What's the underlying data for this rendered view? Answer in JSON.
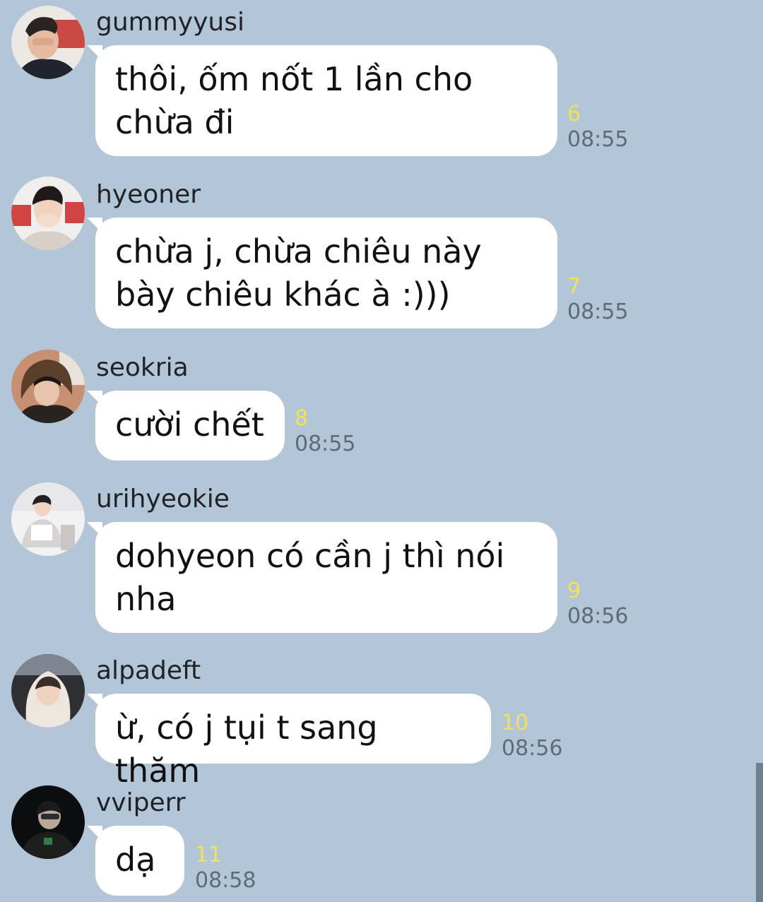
{
  "messages": [
    {
      "sender": "gummyyusi",
      "text": "thôi, ốm nốt 1 lần cho\nchừa đi",
      "read_count": "6",
      "time": "08:55"
    },
    {
      "sender": "hyeoner",
      "text": "chừa j, chừa chiêu này\nbày chiêu khác à :)))",
      "read_count": "7",
      "time": "08:55"
    },
    {
      "sender": "seokria",
      "text": "cười chết",
      "read_count": "8",
      "time": "08:55"
    },
    {
      "sender": "urihyeokie",
      "text": "dohyeon có cần j thì nói\nnha",
      "read_count": "9",
      "time": "08:56"
    },
    {
      "sender": "alpadeft",
      "text": "ừ, có j tụi t sang thăm",
      "read_count": "10",
      "time": "08:56"
    },
    {
      "sender": "vviperr",
      "text": "dạ",
      "read_count": "11",
      "time": "08:58"
    }
  ],
  "colors": {
    "background": "#b3c6d8",
    "bubble": "#ffffff",
    "read_count": "#f2e255",
    "time": "#5d6b79"
  }
}
